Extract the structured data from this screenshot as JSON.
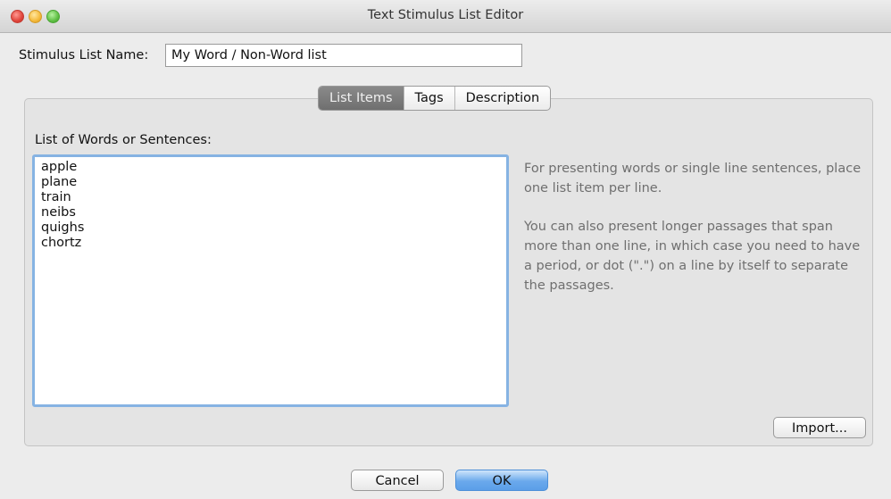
{
  "window": {
    "title": "Text Stimulus List Editor"
  },
  "stimulus_list_name": {
    "label": "Stimulus List Name:",
    "value": "My Word / Non-Word list"
  },
  "tabs": [
    {
      "label": "List Items",
      "selected": true
    },
    {
      "label": "Tags",
      "selected": false
    },
    {
      "label": "Description",
      "selected": false
    }
  ],
  "list_items": {
    "label": "List of Words or Sentences:",
    "value": "apple\nplane\ntrain\nneibs\nquighs\nchortz",
    "help_text_1": "For presenting words or single line sentences, place one list item per line.",
    "help_text_2": "You can also present longer passages that span more than one line, in which case you need to have a period, or dot (\".\") on a line by itself to separate the passages.",
    "import_label": "Import..."
  },
  "footer": {
    "cancel_label": "Cancel",
    "ok_label": "OK"
  },
  "colors": {
    "focus_ring": "#86b3e3",
    "default_button": "#6aa9ec",
    "selected_tab": "#7a7a7a",
    "window_background": "#ececec"
  },
  "icons": [
    "close-window-icon",
    "minimize-window-icon",
    "zoom-window-icon"
  ]
}
